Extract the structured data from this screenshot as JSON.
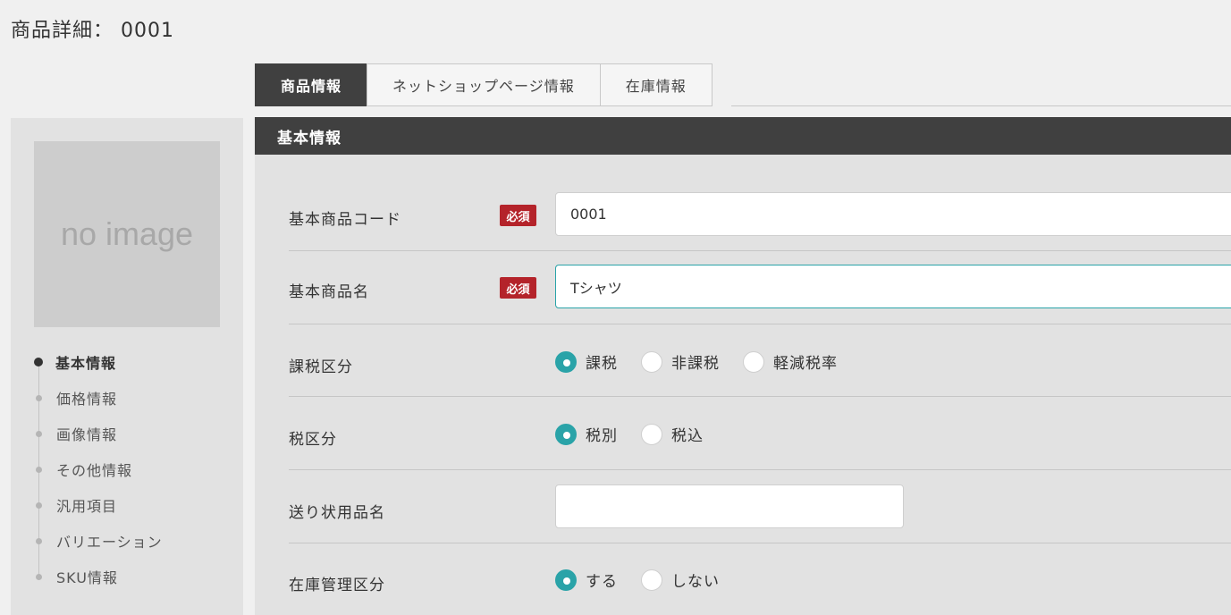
{
  "page_title": "商品詳細： 0001",
  "tabs": [
    {
      "label": "商品情報",
      "active": true
    },
    {
      "label": "ネットショップページ情報",
      "active": false
    },
    {
      "label": "在庫情報",
      "active": false
    }
  ],
  "sidebar": {
    "image_placeholder": "no image",
    "nav": [
      {
        "label": "基本情報",
        "active": true
      },
      {
        "label": "価格情報"
      },
      {
        "label": "画像情報"
      },
      {
        "label": "その他情報"
      },
      {
        "label": "汎用項目"
      },
      {
        "label": "バリエーション"
      },
      {
        "label": "SKU情報"
      }
    ]
  },
  "section": {
    "title": "基本情報"
  },
  "form": {
    "required_badge": "必須",
    "product_code": {
      "label": "基本商品コード",
      "value": "0001"
    },
    "product_name": {
      "label": "基本商品名",
      "value": "Tシャツ"
    },
    "taxation": {
      "label": "課税区分",
      "options": [
        "課税",
        "非課税",
        "軽減税率"
      ],
      "selected": "課税"
    },
    "tax_type": {
      "label": "税区分",
      "options": [
        "税別",
        "税込"
      ],
      "selected": "税別"
    },
    "shipping_name": {
      "label": "送り状用品名",
      "value": ""
    },
    "stock_management": {
      "label": "在庫管理区分",
      "options": [
        "する",
        "しない"
      ],
      "selected": "する"
    }
  },
  "colors": {
    "accent_teal": "#2aa3a8",
    "required_red": "#b4232a",
    "header_dark": "#404040"
  }
}
